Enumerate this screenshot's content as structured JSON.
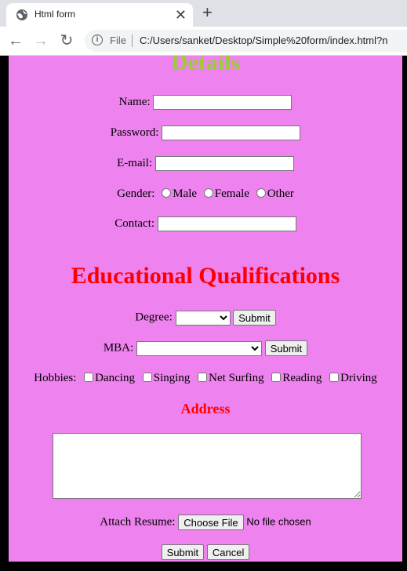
{
  "browser": {
    "tab_title": "Html form",
    "close_symbol": "✕",
    "new_tab_symbol": "+",
    "back_symbol": "←",
    "forward_symbol": "→",
    "reload_symbol": "↻",
    "info_symbol": "i",
    "scheme_label": "File",
    "url": "C:/Users/sanket/Desktop/Simple%20form/index.html?n"
  },
  "form": {
    "details_heading": "Details",
    "name_label": "Name:",
    "name_value": "",
    "password_label": "Password:",
    "password_value": "",
    "email_label": "E-mail:",
    "email_value": "",
    "gender_label": "Gender:",
    "gender_options": [
      "Male",
      "Female",
      "Other"
    ],
    "contact_label": "Contact:",
    "contact_value": "",
    "edu_heading": "Educational Qualifications",
    "degree_label": "Degree:",
    "degree_selected": "",
    "mba_label": "MBA:",
    "mba_selected": "",
    "submit_label": "Submit",
    "hobbies_label": "Hobbies:",
    "hobbies": [
      "Dancing",
      "Singing",
      "Net Surfing",
      "Reading",
      "Driving"
    ],
    "address_heading": "Address",
    "address_value": "",
    "resume_label": "Attach Resume:",
    "choose_file_label": "Choose File",
    "no_file_text": "No file chosen",
    "final_submit_label": "Submit",
    "cancel_label": "Cancel"
  },
  "colors": {
    "page_bg": "#ee82ee",
    "details_heading": "#9acd32",
    "section_heading": "#ff0000"
  },
  "icons": [
    "globe-icon",
    "close-icon",
    "plus-icon",
    "back-arrow-icon",
    "forward-arrow-icon",
    "reload-icon",
    "info-icon"
  ]
}
